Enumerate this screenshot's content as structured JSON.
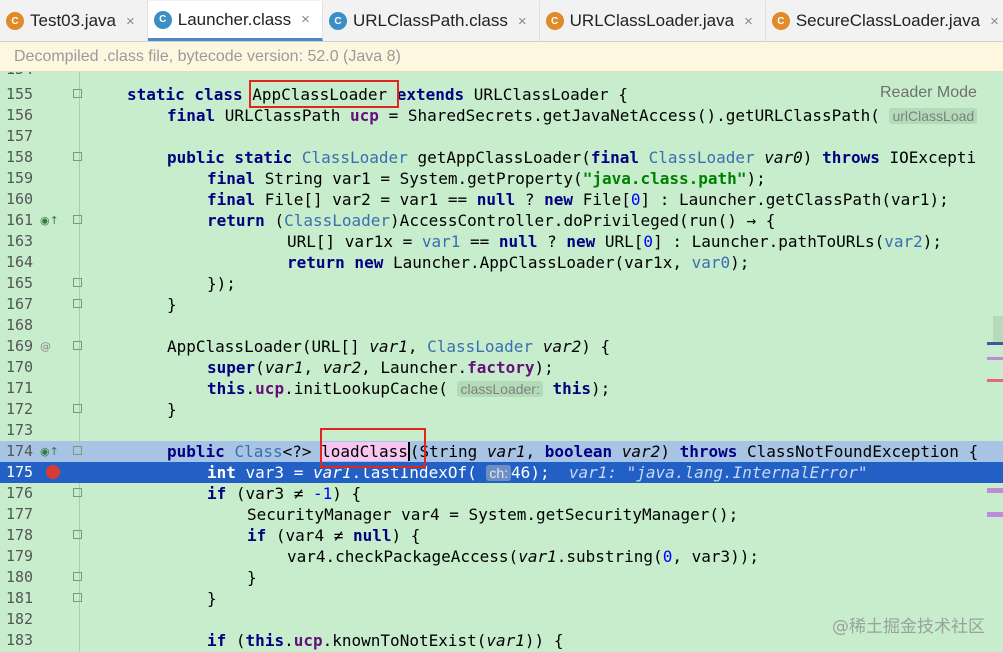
{
  "tabs": [
    {
      "label": "Test03.java",
      "icon": "java-class-icon",
      "active": false
    },
    {
      "label": "Launcher.class",
      "icon": "class-file-icon",
      "active": true
    },
    {
      "label": "URLClassPath.class",
      "icon": "class-file-icon",
      "active": false
    },
    {
      "label": "URLClassLoader.java",
      "icon": "java-class-icon",
      "active": false
    },
    {
      "label": "SecureClassLoader.java",
      "icon": "java-class-icon",
      "active": false
    }
  ],
  "tab_close_glyph": "×",
  "infobar": {
    "text": "Decompiled .class file, bytecode version: 52.0 (Java 8)"
  },
  "reader_mode": {
    "label": "Reader Mode"
  },
  "watermark": {
    "text": "@稀土掘金技术社区"
  },
  "line_numbers": [
    "155",
    "156",
    "157",
    "158",
    "159",
    "160",
    "161",
    "163",
    "164",
    "165",
    "167",
    "168",
    "169",
    "170",
    "171",
    "172",
    "173",
    "174",
    "175",
    "176",
    "177",
    "178",
    "179",
    "180",
    "181",
    "182",
    "183"
  ],
  "code_text": {
    "l155": "static class AppClassLoader extends URLClassLoader {",
    "l156": "final URLClassPath ucp = SharedSecrets.getJavaNetAccess().getURLClassPath(",
    "l156_hint": "urlClassLoad",
    "l158": "public static ClassLoader getAppClassLoader(final ClassLoader var0) throws IOExcepti",
    "l159": "final String var1 = System.getProperty(\"java.class.path\");",
    "l160": "final File[] var2 = var1 == null ? new File[0] : Launcher.getClassPath(var1);",
    "l161": "return (ClassLoader)AccessController.doPrivileged(run() → {",
    "l163": "URL[] var1x = var1 == null ? new URL[0] : Launcher.pathToURLs(var2);",
    "l164": "return new Launcher.AppClassLoader(var1x, var0);",
    "l165": "});",
    "l167": "}",
    "l169": "AppClassLoader(URL[] var1, ClassLoader var2) {",
    "l170": "super(var1, var2, Launcher.factory);",
    "l171": "this.ucp.initLookupCache(",
    "l171_hint": "classLoader:",
    "l171_end": "this);",
    "l172": "}",
    "l174": "public Class<?> loadClass(String var1, boolean var2) throws ClassNotFoundException {",
    "l175": "int var3 = var1.lastIndexOf(",
    "l175_hint": "ch:",
    "l175_end": "46);",
    "l175_debug": "var1: \"java.lang.InternalError\"",
    "l176": "if (var3 ≠ -1) {",
    "l177": "SecurityManager var4 = System.getSecurityManager();",
    "l178": "if (var4 ≠ null) {",
    "l179": "var4.checkPackageAccess(var1.substring(0, var3));",
    "l180": "}",
    "l181": "}",
    "l183": "if (this.ucp.knownToNotExist(var1)) {"
  },
  "colors": {
    "editor_bg": "#c7edcc",
    "current_line": "#a7c4e5",
    "breakpoint_line": "#2360c6",
    "highlight_box": "#e0271f",
    "keyword": "#000080",
    "type": "#3a6fb0"
  }
}
